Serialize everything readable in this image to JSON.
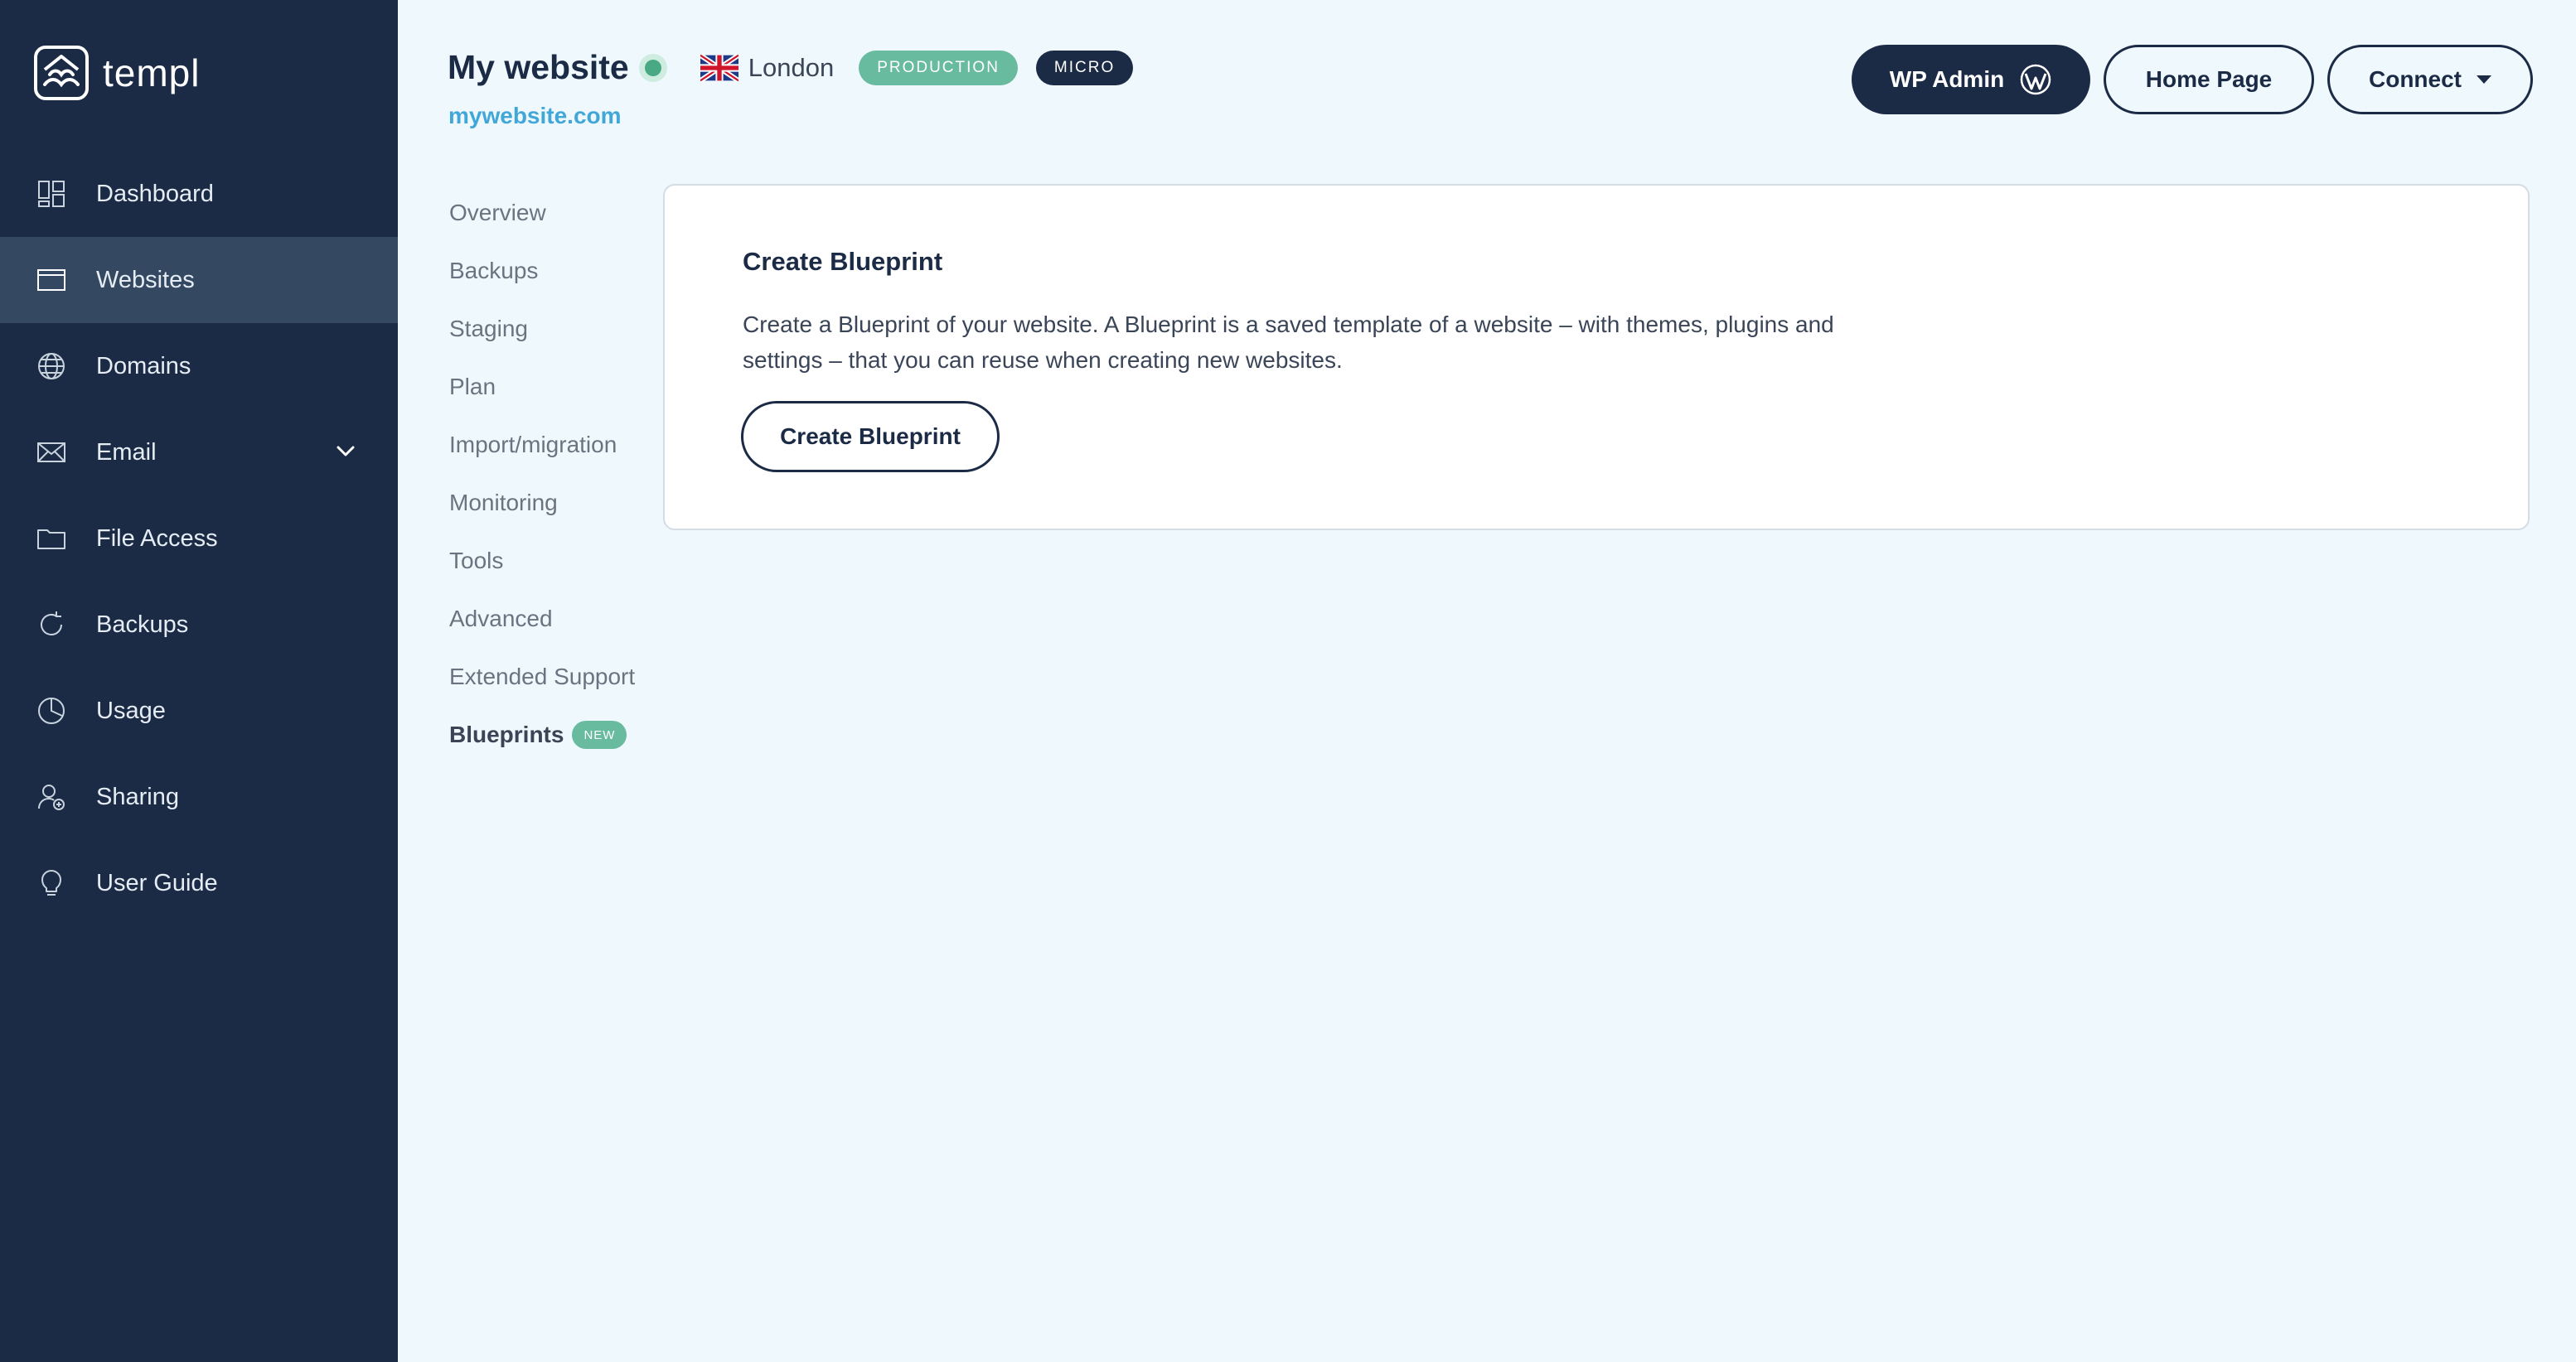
{
  "app": {
    "name": "templ"
  },
  "sidebar": {
    "items": [
      {
        "label": "Dashboard",
        "icon": "dashboard-icon",
        "active": false
      },
      {
        "label": "Websites",
        "icon": "browser-window-icon",
        "active": true
      },
      {
        "label": "Domains",
        "icon": "globe-icon",
        "active": false
      },
      {
        "label": "Email",
        "icon": "envelope-icon",
        "active": false,
        "expandable": true
      },
      {
        "label": "File Access",
        "icon": "folder-icon",
        "active": false
      },
      {
        "label": "Backups",
        "icon": "refresh-icon",
        "active": false
      },
      {
        "label": "Usage",
        "icon": "pie-chart-icon",
        "active": false
      },
      {
        "label": "Sharing",
        "icon": "user-share-icon",
        "active": false
      },
      {
        "label": "User Guide",
        "icon": "lightbulb-icon",
        "active": false
      }
    ]
  },
  "site": {
    "name": "My website",
    "status": "online",
    "location": "London",
    "flag": "uk-flag-icon",
    "environment_badge": "PRODUCTION",
    "plan_badge": "MICRO",
    "domain": "mywebsite.com"
  },
  "header": {
    "wp_admin_label": "WP Admin",
    "home_page_label": "Home Page",
    "connect_label": "Connect"
  },
  "subnav": {
    "items": [
      {
        "label": "Overview"
      },
      {
        "label": "Backups"
      },
      {
        "label": "Staging"
      },
      {
        "label": "Plan"
      },
      {
        "label": "Import/migration"
      },
      {
        "label": "Monitoring"
      },
      {
        "label": "Tools"
      },
      {
        "label": "Advanced"
      },
      {
        "label": "Extended Support"
      },
      {
        "label": "Blueprints",
        "active": true,
        "badge": "NEW"
      }
    ]
  },
  "card": {
    "title": "Create Blueprint",
    "description": "Create a Blueprint of your website. A Blueprint is a saved template of a website – with themes, plugins and settings – that you can reuse when creating new websites.",
    "button_label": "Create Blueprint"
  },
  "colors": {
    "sidebar_bg": "#1b2a45",
    "sidebar_active": "#344862",
    "page_bg": "#eff8fc",
    "accent_green": "#68bb9f",
    "link_blue": "#41a6d8"
  }
}
